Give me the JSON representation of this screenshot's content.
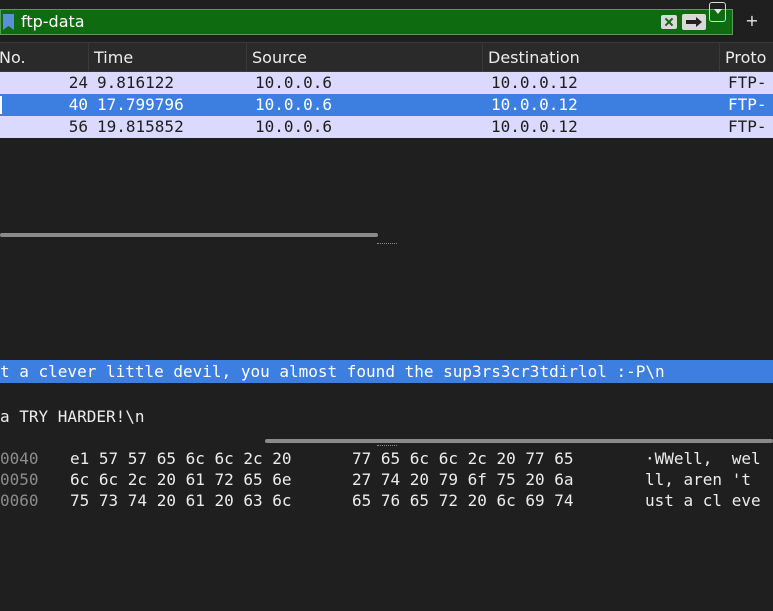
{
  "filter": {
    "value": "ftp-data",
    "add_label": "+"
  },
  "packet_list": {
    "columns": [
      "No.",
      "Time",
      "Source",
      "Destination",
      "Proto"
    ],
    "rows": [
      {
        "no": "24",
        "time": "9.816122",
        "source": "10.0.0.6",
        "destination": "10.0.0.12",
        "protocol": "FTP-"
      },
      {
        "no": "40",
        "time": "17.799796",
        "source": "10.0.0.6",
        "destination": "10.0.0.12",
        "protocol": "FTP-"
      },
      {
        "no": "56",
        "time": "19.815852",
        "source": "10.0.0.6",
        "destination": "10.0.0.12",
        "protocol": "FTP-"
      }
    ],
    "selected_row": 1
  },
  "details": {
    "highlight_line": "t a clever little devil, you almost found the sup3rs3cr3tdirlol :-P\\n",
    "line2": "a TRY HARDER!\\n"
  },
  "bytes": [
    {
      "offset": "0040",
      "hex1": "e1 57 57 65 6c 6c 2c 20",
      "hex2": "77 65 6c 6c 2c 20 77 65",
      "ascii": "·WWell,  wel"
    },
    {
      "offset": "0050",
      "hex1": "6c 6c 2c 20 61 72 65 6e",
      "hex2": "27 74 20 79 6f 75 20 6a",
      "ascii": "ll, aren 't"
    },
    {
      "offset": "0060",
      "hex1": "75 73 74 20 61 20 63 6c",
      "hex2": "65 76 65 72 20 6c 69 74",
      "ascii": "ust a cl eve"
    }
  ],
  "colors": {
    "filter_valid": "#0f6b0f",
    "row_bg": "#dcd9ff",
    "selection": "#3d7fe0",
    "background": "#1f1f1f"
  }
}
